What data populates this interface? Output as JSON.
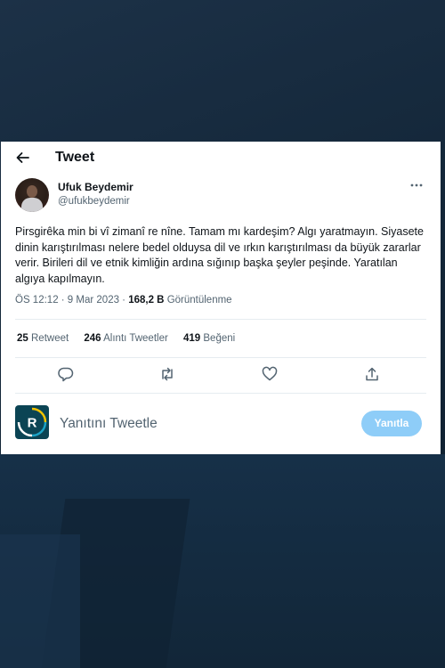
{
  "header": {
    "title": "Tweet",
    "back_icon": "arrow-left-icon"
  },
  "author": {
    "name": "Ufuk Beydemir",
    "handle": "@ufukbeydemir",
    "more_icon": "more-dots-icon"
  },
  "tweet": {
    "text": "Pirsgirêka min bi vî zimanî re nîne. Tamam mı kardeşim? Algı yaratmayın. Siyasete dinin karıştırılması nelere bedel olduysa dil ve ırkın karıştırılması da büyük zararlar verir. Birileri dil ve etnik kimliğin ardına sığınıp başka şeyler peşinde. Yaratılan algıya kapılmayın."
  },
  "meta": {
    "time_date": "ÖS 12:12 · 9 Mar 2023 · ",
    "views_count": "168,2 B",
    "views_label": "Görüntülenme"
  },
  "stats": {
    "retweets_count": "25",
    "retweets_label": "Retweet",
    "quotes_count": "246",
    "quotes_label": "Alıntı Tweetler",
    "likes_count": "419",
    "likes_label": "Beğeni"
  },
  "actions": [
    "reply-icon",
    "retweet-icon",
    "like-icon",
    "share-icon"
  ],
  "reply": {
    "placeholder": "Yanıtını Tweetle",
    "button_label": "Yanıtla",
    "logo_letter": "R"
  },
  "colors": {
    "accent": "#1d9bf0",
    "reply_button": "#8ecdf8",
    "rudaw_bg": "#0b4454",
    "rudaw_yellow": "#f2c200"
  }
}
